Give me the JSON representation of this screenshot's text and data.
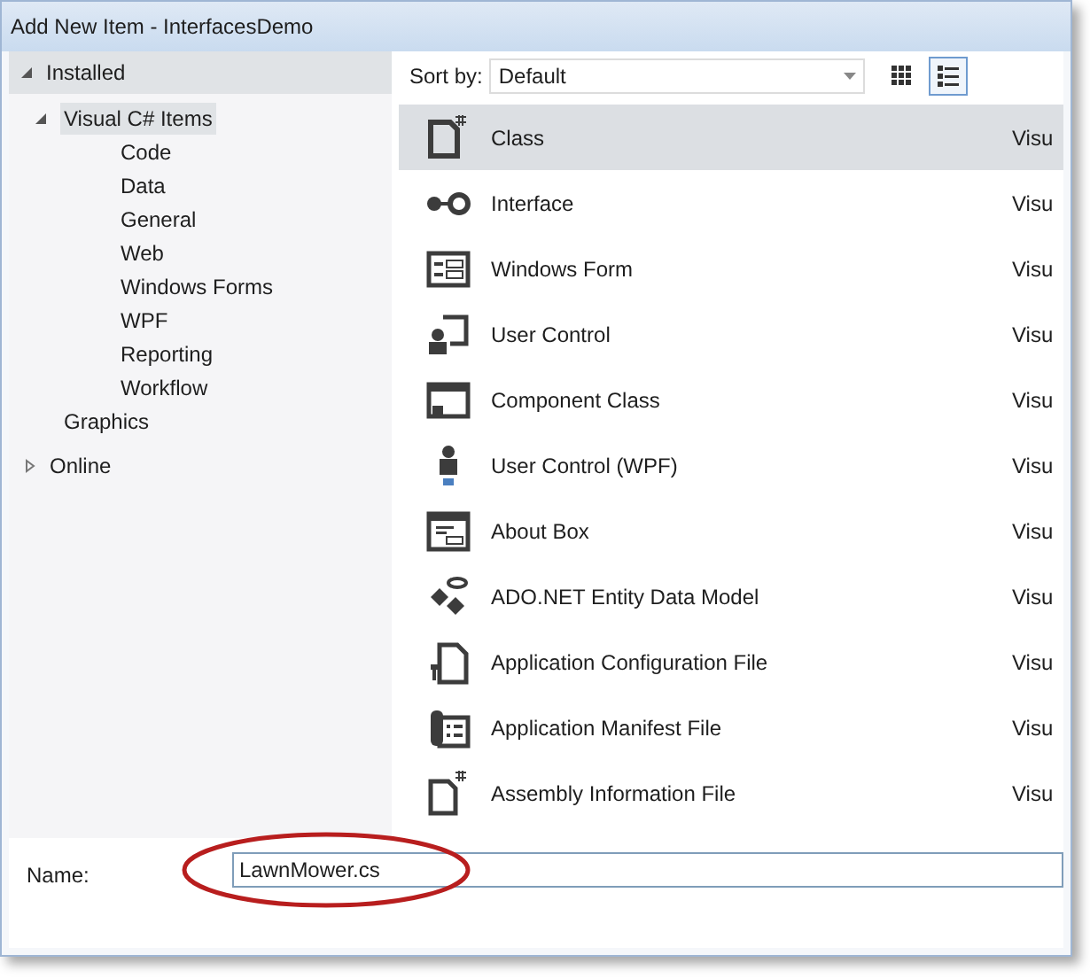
{
  "window": {
    "title": "Add New Item - InterfacesDemo"
  },
  "tree": [
    {
      "label": "Installed",
      "expanded": true,
      "selected": false,
      "children": [
        {
          "label": "Visual C# Items",
          "expanded": true,
          "selected": true,
          "children": [
            {
              "label": "Code",
              "selected": false
            },
            {
              "label": "Data",
              "selected": false
            },
            {
              "label": "General",
              "selected": false
            },
            {
              "label": "Web",
              "selected": false
            },
            {
              "label": "Windows Forms",
              "selected": false
            },
            {
              "label": "WPF",
              "selected": false
            },
            {
              "label": "Reporting",
              "selected": false
            },
            {
              "label": "Workflow",
              "selected": false
            }
          ]
        },
        {
          "label": "Graphics",
          "selected": false
        }
      ]
    },
    {
      "label": "Online",
      "expanded": false,
      "selected": false
    }
  ],
  "sort": {
    "label": "Sort by:",
    "value": "Default"
  },
  "view_buttons": [
    {
      "kind": "small-icons",
      "selected": false
    },
    {
      "kind": "details",
      "selected": true
    }
  ],
  "items": [
    {
      "name": "Class",
      "column_2": "Visu",
      "selected": true
    },
    {
      "name": "Interface",
      "column_2": "Visu",
      "selected": false
    },
    {
      "name": "Windows Form",
      "column_2": "Visu",
      "selected": false
    },
    {
      "name": "User Control",
      "column_2": "Visu",
      "selected": false
    },
    {
      "name": "Component Class",
      "column_2": "Visu",
      "selected": false
    },
    {
      "name": "User Control (WPF)",
      "column_2": "Visu",
      "selected": false
    },
    {
      "name": "About Box",
      "column_2": "Visu",
      "selected": false
    },
    {
      "name": "ADO.NET Entity Data Model",
      "column_2": "Visu",
      "selected": false
    },
    {
      "name": "Application Configuration File",
      "column_2": "Visu",
      "selected": false
    },
    {
      "name": "Application Manifest File",
      "column_2": "Visu",
      "selected": false
    },
    {
      "name": "Assembly Information File",
      "column_2": "Visu",
      "selected": false
    }
  ],
  "name_field": {
    "label": "Name:",
    "value": "LawnMower.cs"
  }
}
